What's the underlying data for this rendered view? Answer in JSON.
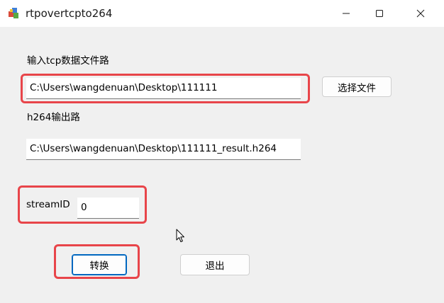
{
  "window": {
    "title": "rtpovertcpto264",
    "icons": {
      "app": "app-icon",
      "minimize": "minimize-icon",
      "maximize": "maximize-icon",
      "close": "close-icon"
    }
  },
  "form": {
    "input_label": "输入tcp数据文件路",
    "input_path": "C:\\Users\\wangdenuan\\Desktop\\111111",
    "select_file_button": "选择文件",
    "output_label": "h264输出路",
    "output_path": "C:\\Users\\wangdenuan\\Desktop\\111111_result.h264",
    "stream_id_label": "streamID",
    "stream_id_value": "0",
    "convert_button": "转换",
    "exit_button": "退出"
  },
  "colors": {
    "highlight": "#e8454a",
    "accent": "#0067c0",
    "background": "#f0f0f0"
  }
}
